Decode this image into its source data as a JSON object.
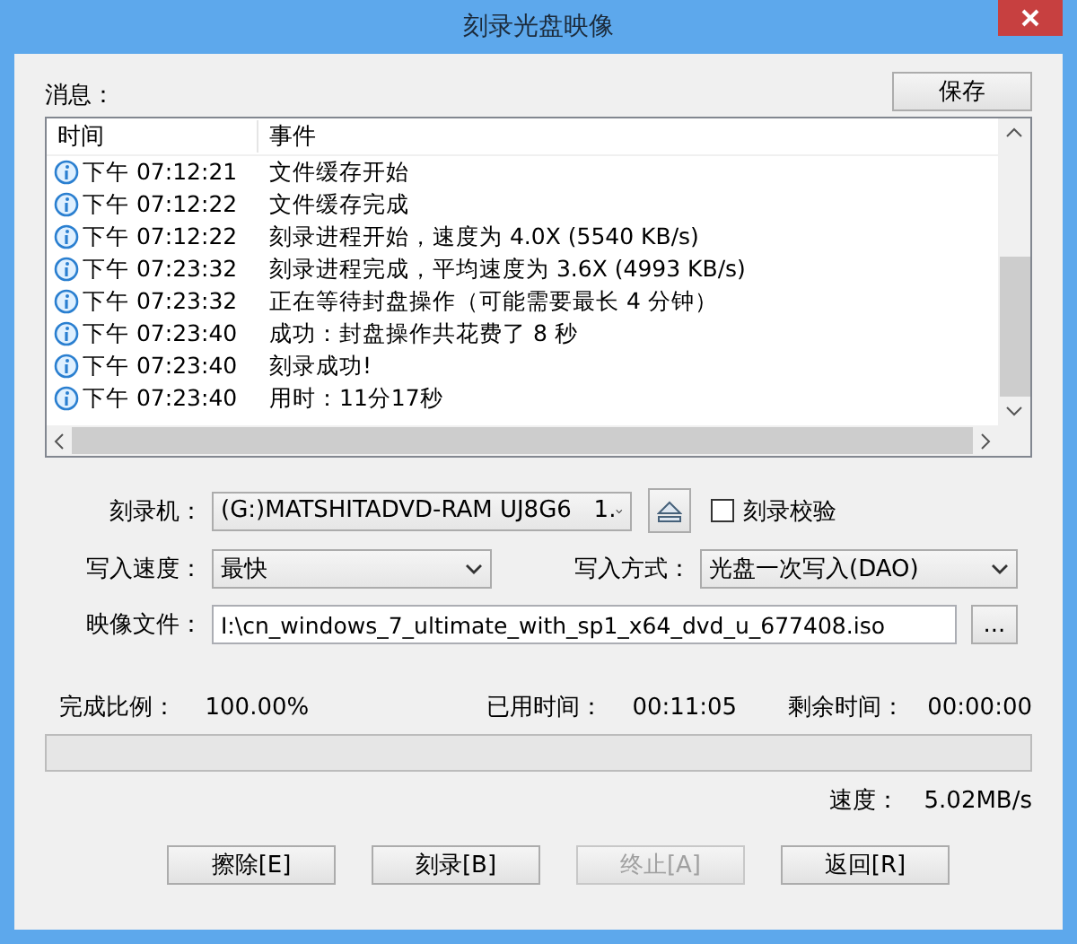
{
  "window": {
    "title": "刻录光盘映像"
  },
  "messages": {
    "label": "消息：",
    "save_button": "保存",
    "columns": [
      "时间",
      "事件"
    ],
    "rows": [
      {
        "time": "下午 07:12:21",
        "event": "文件缓存开始"
      },
      {
        "time": "下午 07:12:22",
        "event": "文件缓存完成"
      },
      {
        "time": "下午 07:12:22",
        "event": "刻录进程开始，速度为 4.0X (5540 KB/s)"
      },
      {
        "time": "下午 07:23:32",
        "event": "刻录进程完成，平均速度为 3.6X (4993 KB/s)"
      },
      {
        "time": "下午 07:23:32",
        "event": "正在等待封盘操作（可能需要最长 4 分钟）"
      },
      {
        "time": "下午 07:23:40",
        "event": "成功：封盘操作共花费了 8 秒"
      },
      {
        "time": "下午 07:23:40",
        "event": "刻录成功!"
      },
      {
        "time": "下午 07:23:40",
        "event": "用时：11分17秒"
      }
    ]
  },
  "form": {
    "burner": {
      "label": "刻录机：",
      "value": "(G:)MATSHITADVD-RAM UJ8G6   1."
    },
    "verify": {
      "label": "刻录校验",
      "checked": false
    },
    "speed": {
      "label": "写入速度：",
      "value": "最快"
    },
    "mode": {
      "label": "写入方式：",
      "value": "光盘一次写入(DAO)"
    },
    "image": {
      "label": "映像文件：",
      "value": "I:\\cn_windows_7_ultimate_with_sp1_x64_dvd_u_677408.iso",
      "browse": "..."
    }
  },
  "progress": {
    "percent_label": "完成比例：",
    "percent": "100.00%",
    "elapsed_label": "已用时间：",
    "elapsed": "00:11:05",
    "remaining_label": "剩余时间：",
    "remaining": "00:00:00",
    "level": 0,
    "speed_label": "速度：",
    "speed": "5.02MB/s"
  },
  "buttons": [
    {
      "label": "擦除[E]",
      "disabled": false
    },
    {
      "label": "刻录[B]",
      "disabled": false
    },
    {
      "label": "终止[A]",
      "disabled": true
    },
    {
      "label": "返回[R]",
      "disabled": false
    }
  ]
}
